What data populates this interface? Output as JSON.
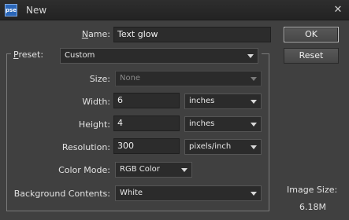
{
  "window": {
    "title": "New",
    "app_icon_label": "pse",
    "close_glyph": "✕"
  },
  "name": {
    "label": "Name:",
    "value": "Text glow"
  },
  "preset": {
    "label": "Preset:",
    "value": "Custom"
  },
  "size": {
    "label": "Size:",
    "value": "None"
  },
  "width": {
    "label": "Width:",
    "value": "6",
    "unit": "inches"
  },
  "height": {
    "label": "Height:",
    "value": "4",
    "unit": "inches"
  },
  "resolution": {
    "label": "Resolution:",
    "value": "300",
    "unit": "pixels/inch"
  },
  "color_mode": {
    "label": "Color Mode:",
    "value": "RGB Color"
  },
  "background": {
    "label": "Background Contents:",
    "value": "White"
  },
  "buttons": {
    "ok": "OK",
    "reset": "Reset"
  },
  "image_size": {
    "label": "Image Size:",
    "value": "6.18M"
  }
}
